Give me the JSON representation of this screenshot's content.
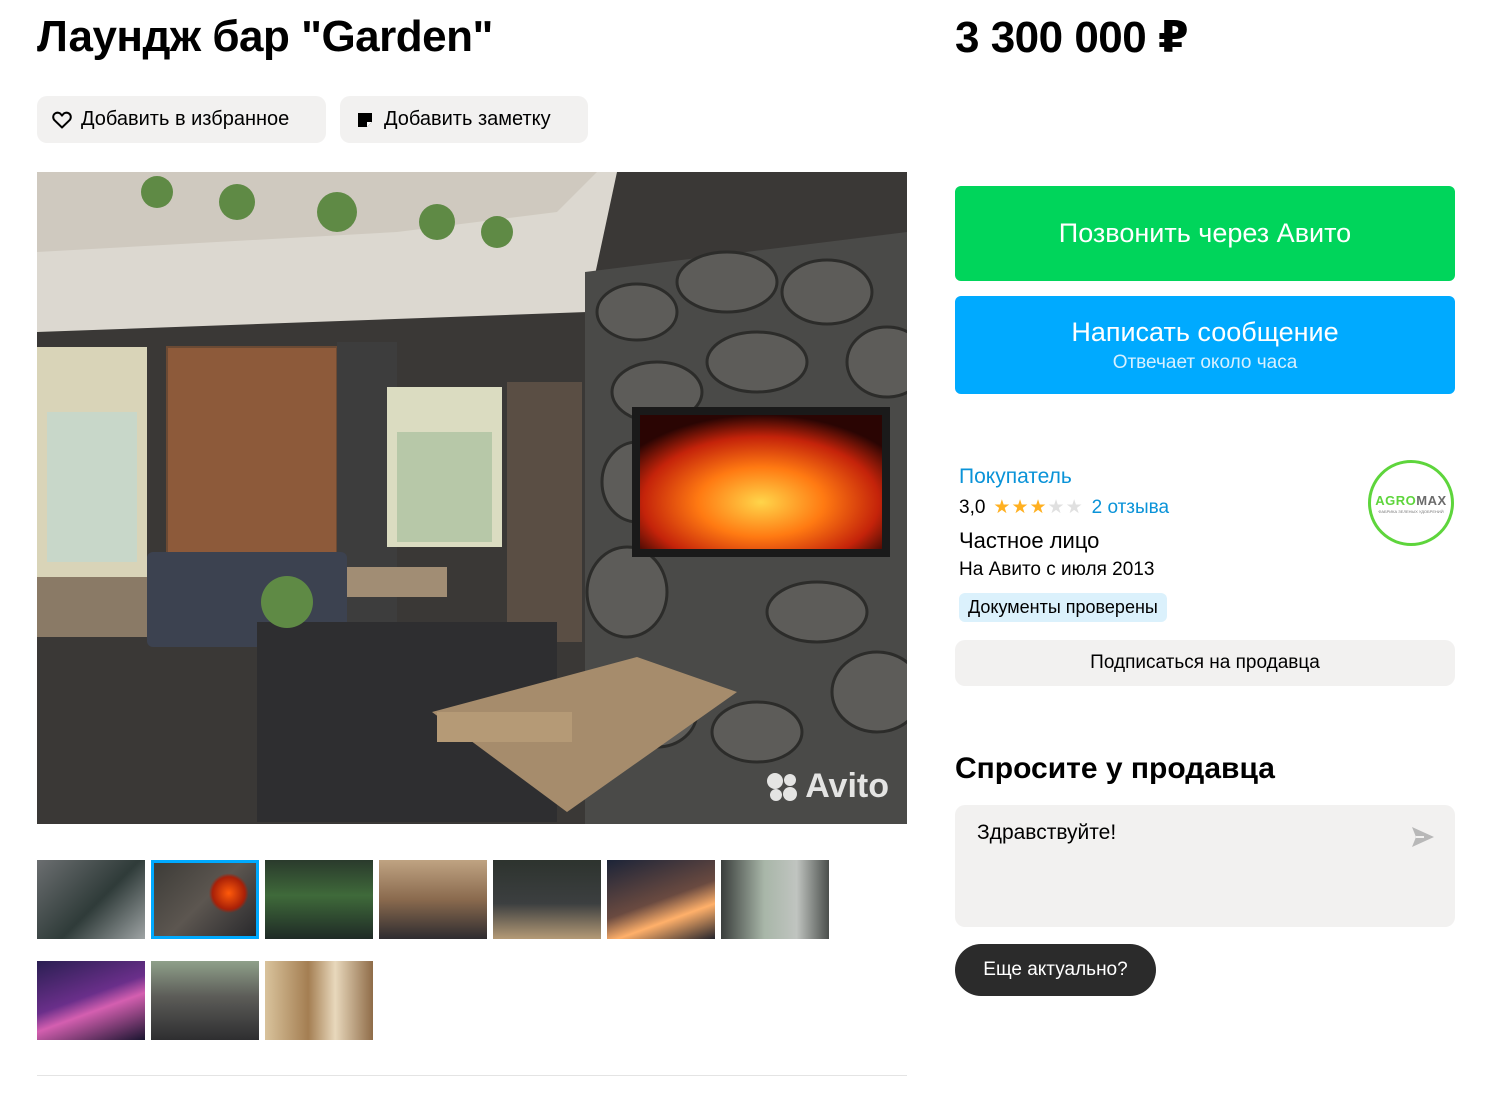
{
  "listing": {
    "title": "Лаундж бар \"Garden\"",
    "price": "3 300 000 ₽"
  },
  "actions": {
    "favorite_label": "Добавить в избранное",
    "note_label": "Добавить заметку"
  },
  "gallery": {
    "watermark": "Avito",
    "thumbnail_count": 10,
    "active_thumbnail": 2
  },
  "contact": {
    "call_label": "Позвонить через Авито",
    "message_label": "Написать сообщение",
    "message_sub": "Отвечает около часа"
  },
  "seller": {
    "name": "Покупатель",
    "rating": "3,0",
    "rating_value": 3,
    "rating_max": 5,
    "reviews": "2 отзыва",
    "type": "Частное лицо",
    "since": "На Авито с июля 2013",
    "verified": "Документы проверены",
    "subscribe_label": "Подписаться на продавца",
    "logo": {
      "brand_a": "AGRO",
      "brand_b": "MAX",
      "tagline": "ФАБРИКА ЗЕЛЕНЫХ УДОБРЕНИЙ"
    }
  },
  "ask": {
    "title": "Спросите у продавца",
    "message_value": "Здравствуйте!",
    "quick_reply": "Еще актуально?"
  },
  "colors": {
    "call_green": "#00d55b",
    "message_blue": "#00aaff",
    "link_blue": "#0a93d8",
    "star": "#ffb021",
    "logo_green": "#5ed53c"
  }
}
